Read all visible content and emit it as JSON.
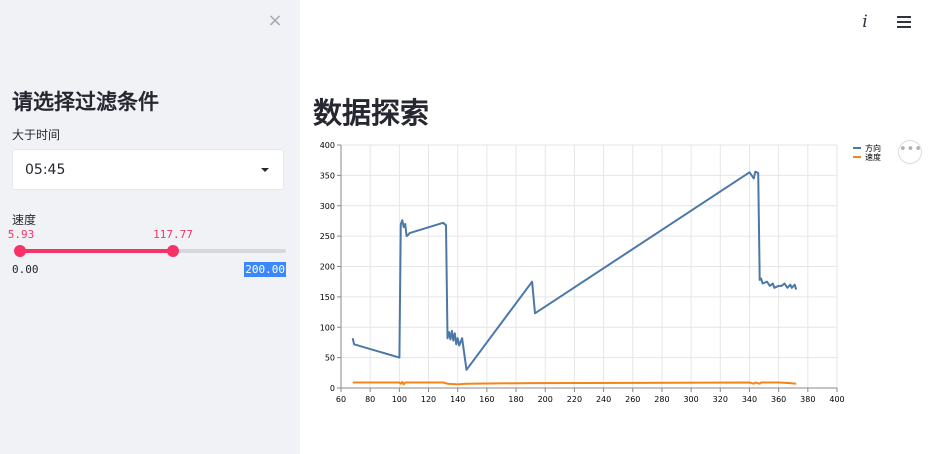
{
  "sidebar": {
    "close_label": "×",
    "title": "请选择过滤条件",
    "time_label": "大于时间",
    "time_value": "05:45",
    "speed_label": "速度",
    "slider": {
      "min_label": "0.00",
      "max_label": "200.00",
      "low_label": "5.93",
      "high_label": "117.77",
      "min": 0,
      "max": 200,
      "low": 5.93,
      "high": 117.77
    }
  },
  "header": {
    "info_icon": "info-icon",
    "menu_icon": "hamburger-menu-icon",
    "info_glyph": "i"
  },
  "main": {
    "title": "数据探索",
    "actions_glyph": "•••"
  },
  "colors": {
    "accent": "#f63366",
    "sidebar_bg": "#f0f2f6",
    "series_direction": "#4c78a8",
    "series_speed": "#f58518",
    "highlight": "#3b88fd"
  },
  "chart_data": {
    "type": "line",
    "xlim": [
      60,
      400
    ],
    "ylim": [
      0,
      400
    ],
    "xticks": [
      60,
      80,
      100,
      120,
      140,
      160,
      180,
      200,
      220,
      240,
      260,
      280,
      300,
      320,
      340,
      360,
      380,
      400
    ],
    "yticks": [
      0,
      50,
      100,
      150,
      200,
      250,
      300,
      350,
      400
    ],
    "grid": true,
    "legend_position": "top-right",
    "series": [
      {
        "name": "方向",
        "color": "#4c78a8",
        "points": [
          [
            68,
            82
          ],
          [
            69,
            72
          ],
          [
            100,
            50
          ],
          [
            101,
            270
          ],
          [
            102,
            276
          ],
          [
            103,
            265
          ],
          [
            104,
            270
          ],
          [
            105,
            250
          ],
          [
            106,
            252
          ],
          [
            107,
            255
          ],
          [
            130,
            272
          ],
          [
            132,
            268
          ],
          [
            133,
            82
          ],
          [
            134,
            92
          ],
          [
            135,
            80
          ],
          [
            136,
            94
          ],
          [
            137,
            78
          ],
          [
            138,
            90
          ],
          [
            139,
            72
          ],
          [
            140,
            82
          ],
          [
            141,
            70
          ],
          [
            143,
            82
          ],
          [
            146,
            30
          ],
          [
            191,
            175
          ],
          [
            193,
            123
          ],
          [
            340,
            355
          ],
          [
            343,
            345
          ],
          [
            344,
            356
          ],
          [
            346,
            354
          ],
          [
            347,
            178
          ],
          [
            348,
            180
          ],
          [
            349,
            172
          ],
          [
            352,
            175
          ],
          [
            354,
            168
          ],
          [
            356,
            172
          ],
          [
            357,
            165
          ],
          [
            360,
            168
          ],
          [
            362,
            168
          ],
          [
            364,
            172
          ],
          [
            366,
            165
          ],
          [
            368,
            170
          ],
          [
            369,
            165
          ],
          [
            371,
            170
          ],
          [
            372,
            162
          ]
        ]
      },
      {
        "name": "速度",
        "color": "#f58518",
        "points": [
          [
            68,
            9
          ],
          [
            100,
            9
          ],
          [
            101,
            7
          ],
          [
            102,
            10
          ],
          [
            103,
            6
          ],
          [
            104,
            9
          ],
          [
            130,
            9
          ],
          [
            133,
            7
          ],
          [
            140,
            6
          ],
          [
            146,
            7
          ],
          [
            191,
            8
          ],
          [
            340,
            9
          ],
          [
            343,
            7
          ],
          [
            344,
            9
          ],
          [
            347,
            7
          ],
          [
            348,
            9
          ],
          [
            360,
            9
          ],
          [
            368,
            8
          ],
          [
            372,
            7
          ]
        ]
      }
    ]
  }
}
